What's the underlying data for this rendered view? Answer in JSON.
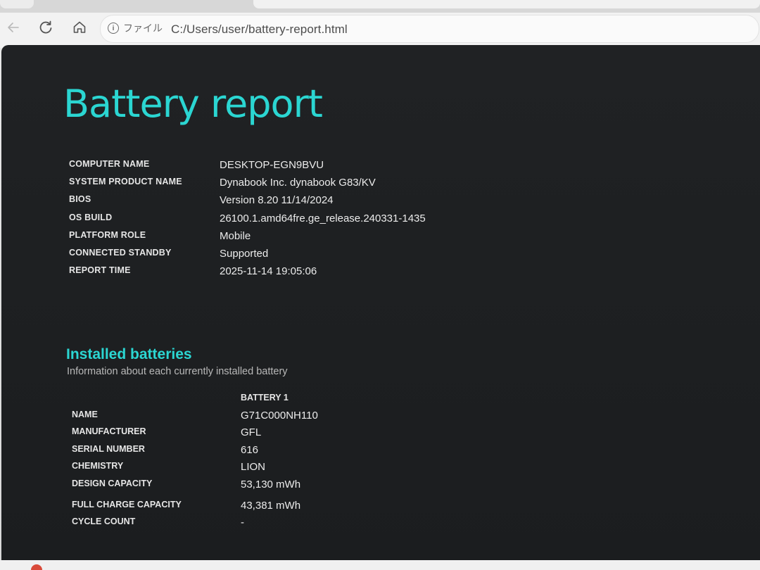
{
  "browser": {
    "site_label": "ファイル",
    "url": "C:/Users/user/battery-report.html",
    "icons": [
      "back-arrow-icon",
      "reload-icon",
      "home-icon",
      "info-icon"
    ]
  },
  "report": {
    "title": "Battery report",
    "system_info": [
      {
        "label": "COMPUTER NAME",
        "value": "DESKTOP-EGN9BVU"
      },
      {
        "label": "SYSTEM PRODUCT NAME",
        "value": "Dynabook Inc. dynabook G83/KV"
      },
      {
        "label": "BIOS",
        "value": "Version 8.20 11/14/2024"
      },
      {
        "label": "OS BUILD",
        "value": "26100.1.amd64fre.ge_release.240331-1435"
      },
      {
        "label": "PLATFORM ROLE",
        "value": "Mobile"
      },
      {
        "label": "CONNECTED STANDBY",
        "value": "Supported"
      },
      {
        "label": "REPORT TIME",
        "value": "2025-11-14  19:05:06"
      }
    ]
  },
  "installed_batteries": {
    "title": "Installed batteries",
    "subtitle": "Information about each currently installed battery",
    "column_header": "BATTERY 1",
    "rows": [
      {
        "label": "NAME",
        "value": "G71C000NH110"
      },
      {
        "label": "MANUFACTURER",
        "value": "GFL"
      },
      {
        "label": "SERIAL NUMBER",
        "value": "616"
      },
      {
        "label": "CHEMISTRY",
        "value": "LION"
      },
      {
        "label": "DESIGN CAPACITY",
        "value": "53,130 mWh"
      },
      {
        "label": "FULL CHARGE CAPACITY",
        "value": "43,381 mWh"
      },
      {
        "label": "CYCLE COUNT",
        "value": "-"
      }
    ]
  },
  "colors": {
    "accent": "#2bd6d2",
    "page_background": "#1e2022",
    "text": "#ececec"
  }
}
